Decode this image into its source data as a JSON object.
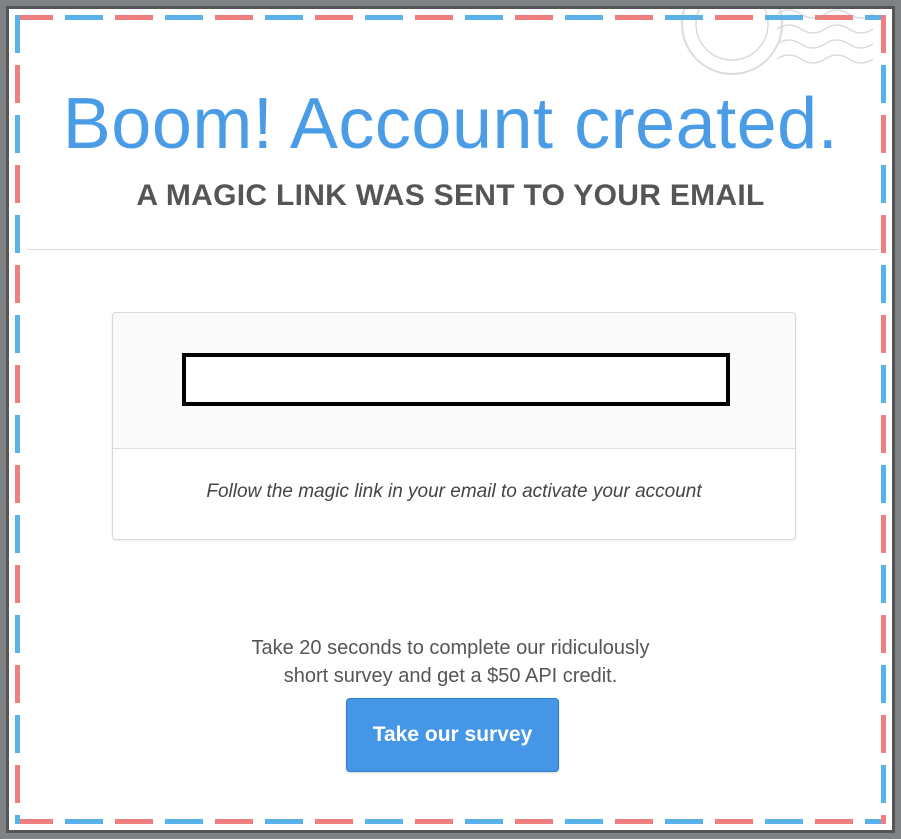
{
  "modal": {
    "headline": "Boom! Account created.",
    "subheadline": "A MAGIC LINK WAS SENT TO YOUR EMAIL",
    "email_value": "",
    "card_note": "Follow the magic link in your email to activate your account",
    "survey_line1": "Take 20 seconds to complete our ridiculously",
    "survey_line2": "short survey and get a $50 API credit.",
    "survey_button_label": "Take our survey"
  },
  "colors": {
    "accent_blue": "#4596e6",
    "headline_blue": "#4a9ce6",
    "stripe_red": "#ef7f7f",
    "stripe_blue": "#5ab2ea"
  },
  "icons": [
    "postmark-stamp-icon"
  ]
}
